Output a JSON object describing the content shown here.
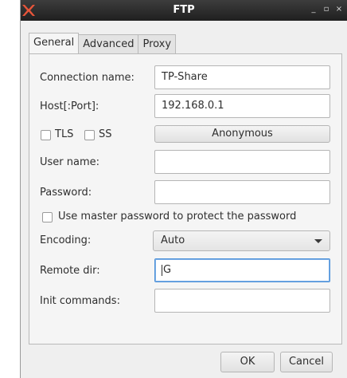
{
  "window": {
    "title": "FTP",
    "minimize_glyph": "_",
    "maximize_glyph": "▫",
    "close_glyph": "×"
  },
  "tabs": [
    {
      "label": "General",
      "active": true
    },
    {
      "label": "Advanced",
      "active": false
    },
    {
      "label": "Proxy",
      "active": false
    }
  ],
  "form": {
    "connection_name_label": "Connection name:",
    "connection_name_value": "TP-Share",
    "host_label": "Host[:Port]:",
    "host_value": "192.168.0.1",
    "tls_label": "TLS",
    "ssl_label": "SS",
    "anonymous_button": "Anonymous",
    "username_label": "User name:",
    "username_value": "",
    "password_label": "Password:",
    "password_value": "",
    "master_password_label": "Use master password to protect the password",
    "encoding_label": "Encoding:",
    "encoding_value": "Auto",
    "remote_dir_label": "Remote dir:",
    "remote_dir_value": "G",
    "init_commands_label": "Init commands:",
    "init_commands_value": ""
  },
  "buttons": {
    "ok": "OK",
    "cancel": "Cancel"
  },
  "colors": {
    "titlebar": "#2a2a2a",
    "logo": "#e8553a",
    "focus": "#4a90d9"
  }
}
